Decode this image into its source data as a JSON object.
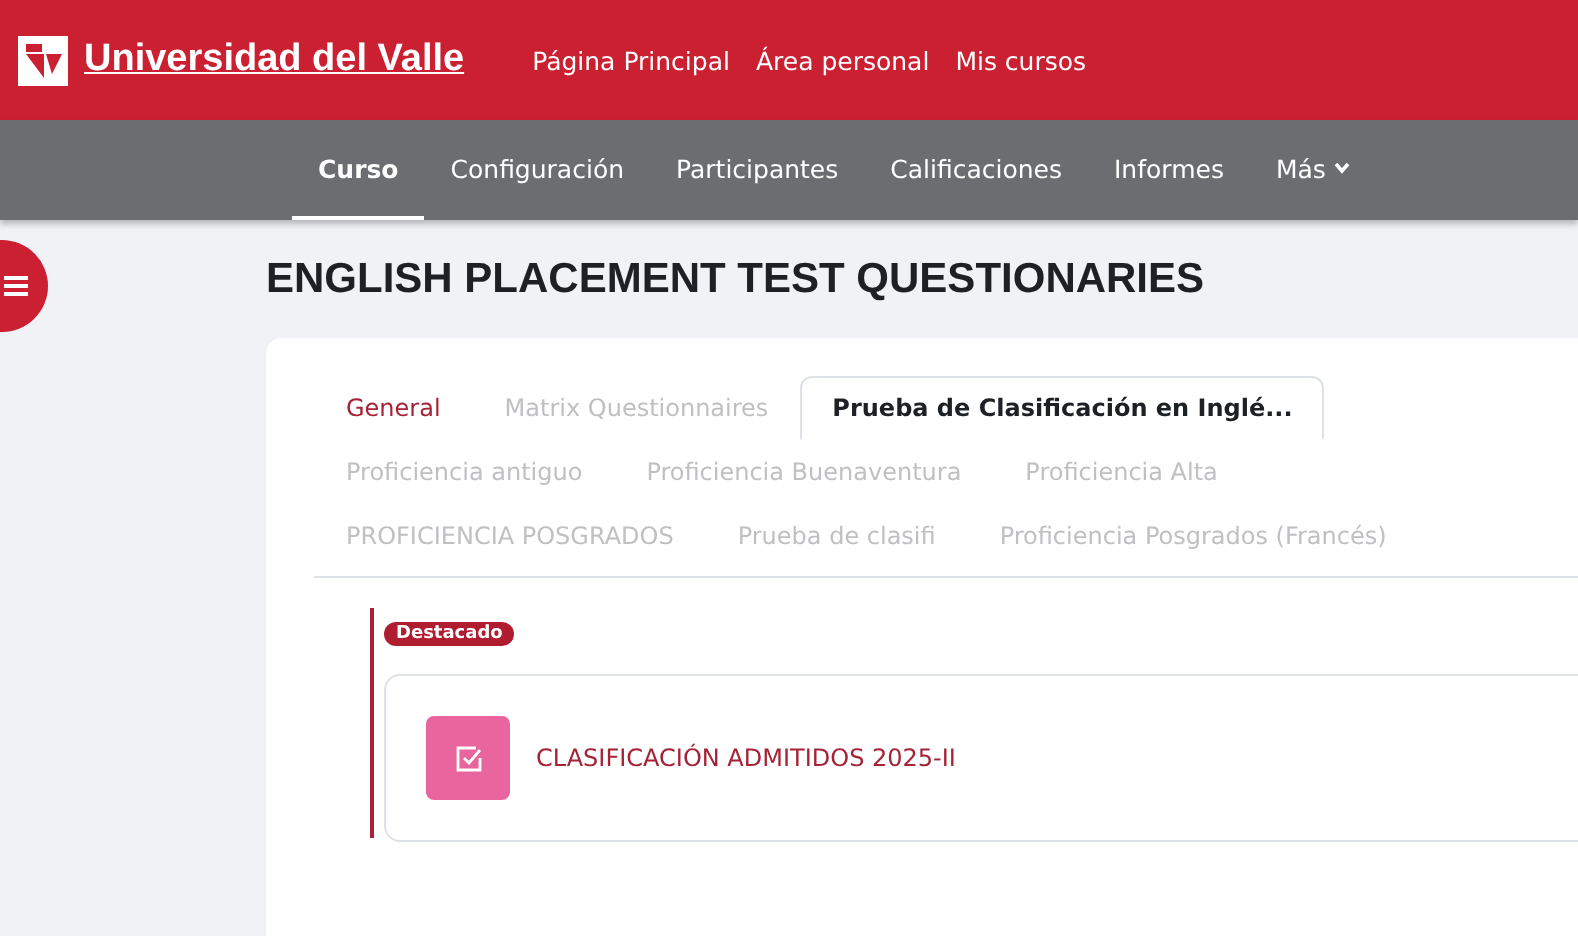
{
  "header": {
    "brand": "Universidad del Valle",
    "links": [
      "Página Principal",
      "Área personal",
      "Mis cursos"
    ]
  },
  "course_nav": [
    {
      "label": "Curso",
      "selected": true
    },
    {
      "label": "Configuración",
      "selected": false
    },
    {
      "label": "Participantes",
      "selected": false
    },
    {
      "label": "Calificaciones",
      "selected": false
    },
    {
      "label": "Informes",
      "selected": false
    },
    {
      "label": "Más",
      "selected": false,
      "kind": "dropdown"
    }
  ],
  "page_title": "ENGLISH PLACEMENT TEST QUESTIONARIES",
  "tabs": [
    {
      "label": "General",
      "selected": false,
      "kind": "link"
    },
    {
      "label": "Matrix Questionnaires",
      "selected": false,
      "kind": "muted"
    },
    {
      "label": "Prueba de Clasificación en Inglé...",
      "selected": true,
      "kind": "muted"
    },
    {
      "label": "Proficiencia antiguo",
      "selected": false,
      "kind": "muted"
    },
    {
      "label": "Proficiencia Buenaventura",
      "selected": false,
      "kind": "muted"
    },
    {
      "label": "Proficiencia Alta",
      "selected": false,
      "kind": "muted"
    },
    {
      "label": "PROFICIENCIA POSGRADOS",
      "selected": false,
      "kind": "muted"
    },
    {
      "label": "Prueba de clasifi",
      "selected": false,
      "kind": "muted"
    },
    {
      "label": "Proficiencia Posgrados (Francés)",
      "selected": false,
      "kind": "muted"
    }
  ],
  "section": {
    "badge": "Destacado",
    "activities": [
      {
        "name": "CLASIFICACIÓN ADMITIDOS 2025-II",
        "kind": "quiz"
      }
    ]
  }
}
